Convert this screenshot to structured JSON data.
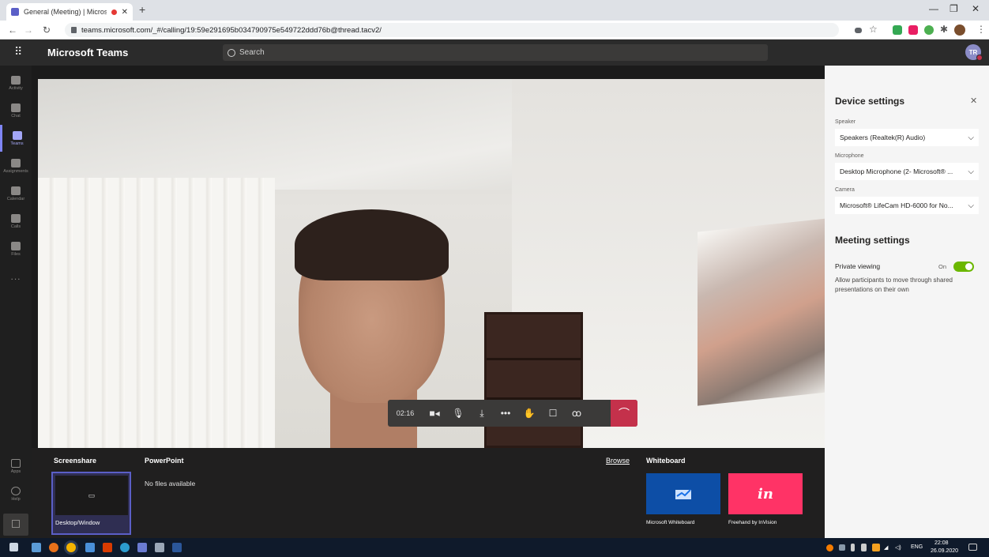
{
  "browser": {
    "tab_title": "General (Meeting) | Microsof",
    "url": "teams.microsoft.com/_#/calling/19:59e291695b034790975e549722ddd76b@thread.tacv2/"
  },
  "teams": {
    "app_title": "Microsoft Teams",
    "search_placeholder": "Search",
    "avatar_initials": "TR"
  },
  "rail": {
    "items": [
      {
        "label": "Activity"
      },
      {
        "label": "Chat"
      },
      {
        "label": "Teams"
      },
      {
        "label": "Assignments"
      },
      {
        "label": "Calendar"
      },
      {
        "label": "Calls"
      },
      {
        "label": "Files"
      }
    ],
    "more": "...",
    "bottom": [
      {
        "label": "Apps"
      },
      {
        "label": "Help"
      }
    ]
  },
  "call": {
    "timer": "02:16"
  },
  "tray": {
    "screenshare_heading": "Screenshare",
    "desktop_label": "Desktop/Window",
    "powerpoint_heading": "PowerPoint",
    "no_files": "No files available",
    "browse": "Browse",
    "whiteboard_heading": "Whiteboard",
    "whiteboard_options": [
      {
        "label": "Microsoft Whiteboard",
        "color": "#0d4ea6"
      },
      {
        "label": "Freehand by InVision",
        "color": "#ff3366",
        "glyph": "in"
      }
    ]
  },
  "panel": {
    "device_title": "Device settings",
    "speaker_label": "Speaker",
    "speaker_value": "Speakers (Realtek(R) Audio)",
    "mic_label": "Microphone",
    "mic_value": "Desktop Microphone (2- Microsoft® ...",
    "camera_label": "Camera",
    "camera_value": "Microsoft® LifeCam HD-6000 for No...",
    "meeting_title": "Meeting settings",
    "private_label": "Private viewing",
    "private_state": "On",
    "private_desc": "Allow participants to move through shared presentations on their own"
  },
  "taskbar": {
    "lang": "ENG",
    "time": "22:08",
    "date": "26.09.2020"
  },
  "colors": {
    "accent": "#6264a7",
    "hangup": "#c4314b",
    "toggle_on": "#6bb700"
  }
}
